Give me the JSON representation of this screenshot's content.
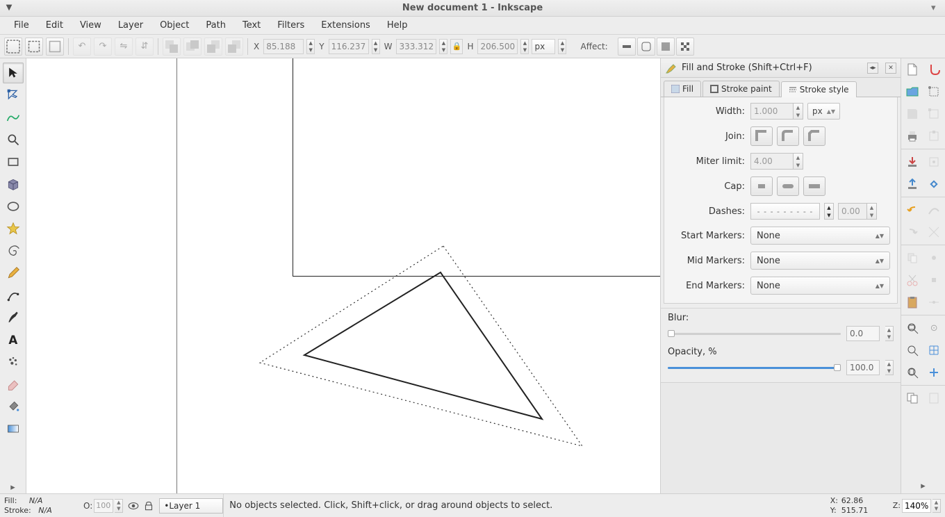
{
  "title": "New document 1 - Inkscape",
  "menu": [
    "File",
    "Edit",
    "View",
    "Layer",
    "Object",
    "Path",
    "Text",
    "Filters",
    "Extensions",
    "Help"
  ],
  "optbar": {
    "x_label": "X",
    "x": "85.188",
    "y_label": "Y",
    "y": "116.237",
    "w_label": "W",
    "w": "333.312",
    "h_label": "H",
    "h": "206.500",
    "unit": "px",
    "affect_label": "Affect:"
  },
  "dock": {
    "title": "Fill and Stroke (Shift+Ctrl+F)",
    "tabs": {
      "fill": "Fill",
      "stroke_paint": "Stroke paint",
      "stroke_style": "Stroke style"
    },
    "labels": {
      "width": "Width:",
      "join": "Join:",
      "miter": "Miter limit:",
      "cap": "Cap:",
      "dashes": "Dashes:",
      "start": "Start Markers:",
      "mid": "Mid Markers:",
      "end": "End Markers:",
      "blur": "Blur:",
      "opacity": "Opacity, %"
    },
    "values": {
      "width": "1.000",
      "width_unit": "px",
      "miter": "4.00",
      "dash_offset": "0.00",
      "dash_pattern": "- - - - - - - - -",
      "start": "None",
      "mid": "None",
      "end": "None",
      "blur": "0.0",
      "opacity": "100.0"
    }
  },
  "status": {
    "fill_label": "Fill:",
    "fill": "N/A",
    "stroke_label": "Stroke:",
    "stroke": "N/A",
    "o_label": "O:",
    "o": "100",
    "layer": "Layer 1",
    "hint": "No objects selected. Click, Shift+click, or drag around objects to select.",
    "x_label": "X:",
    "x": "62.86",
    "y_label": "Y:",
    "y": "515.71",
    "z_label": "Z:",
    "zoom": "140%"
  }
}
